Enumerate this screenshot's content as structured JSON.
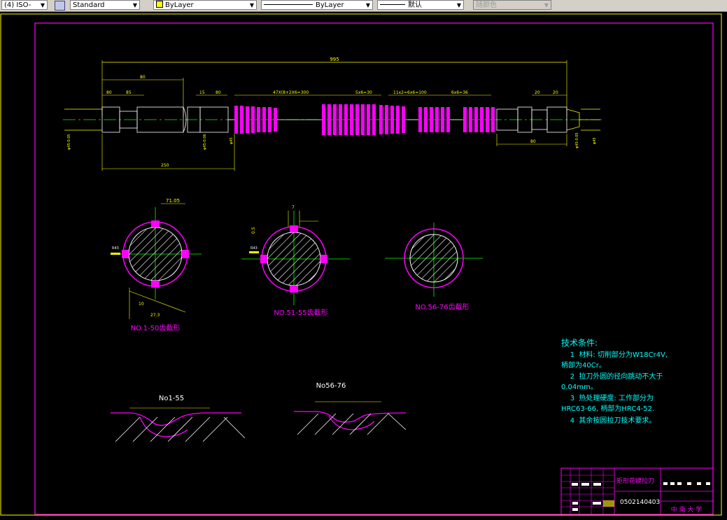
{
  "toolbar": {
    "dimstyle": "(4) ISO-",
    "textstyle": "Standard",
    "layer": "ByLayer",
    "linetype": "ByLayer",
    "lineweight": "默认",
    "plotstyle": "随颜色"
  },
  "drawing": {
    "overall_length": "995",
    "dim_top": [
      "80",
      "85",
      "20",
      "15",
      "80",
      "47X(8+2X6=300",
      "5x6=30",
      "11x2=6x6=100",
      "6x6=36",
      "20",
      "20"
    ],
    "dim_bottom_left": "250",
    "dim_bottom_right": "80",
    "section1": {
      "label": "NO.1-50齿截形",
      "dims": [
        "71.05",
        "27.3",
        "10",
        "R43"
      ]
    },
    "section2": {
      "label": "NO.51-55齿截形",
      "dims": [
        "7",
        "0.5",
        "R43"
      ]
    },
    "section3": {
      "label": "NO.56-76齿截形"
    },
    "profile1": {
      "label": "No1-55"
    },
    "profile2": {
      "label": "No56-76"
    }
  },
  "notes": {
    "title": "技术条件:",
    "lines": [
      "    1  材料: 切削部分为W18Cr4V,",
      "柄部为40Cr。",
      "    2  拉刀外圆的径向跳动不大于",
      "0.04mm。",
      "    3  热处理硬度: 工作部分为",
      "HRC63-66, 柄部为HRC4-52.",
      "    4  其余按圆拉刀技术要求。"
    ]
  },
  "title_block": {
    "name": "矩形花键拉刀",
    "number": "0502140403",
    "school": "中 南 大 学"
  },
  "colors": {
    "magenta": "#ff00ff",
    "yellow": "#ffff00",
    "green": "#00ff00",
    "white": "#ffffff",
    "cyan": "#00ffff"
  }
}
